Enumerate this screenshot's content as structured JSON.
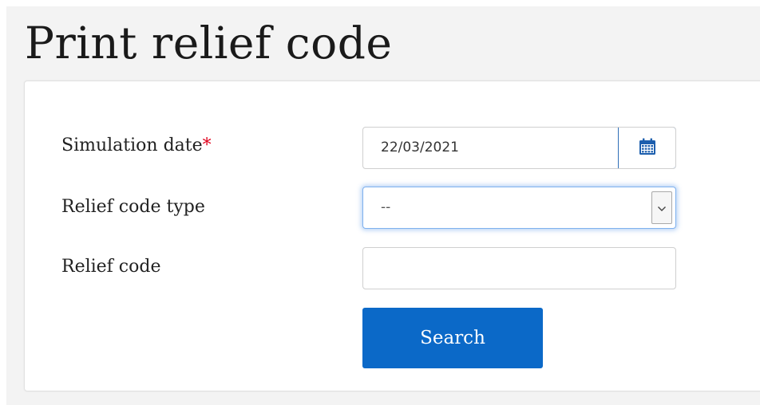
{
  "page": {
    "title": "Print relief code"
  },
  "form": {
    "simulation_date": {
      "label": "Simulation date",
      "required_marker": "*",
      "value": "22/03/2021",
      "calendar_icon": "calendar-icon"
    },
    "relief_code_type": {
      "label": "Relief code type",
      "selected": "--",
      "arrow_icon": "chevron-down-icon"
    },
    "relief_code": {
      "label": "Relief code",
      "value": ""
    },
    "search_label": "Search"
  },
  "colors": {
    "primary_button": "#0b69c8",
    "required_marker": "#e0001b",
    "focus_ring": "#7fb1ee",
    "calendar_icon": "#1d5fae"
  }
}
